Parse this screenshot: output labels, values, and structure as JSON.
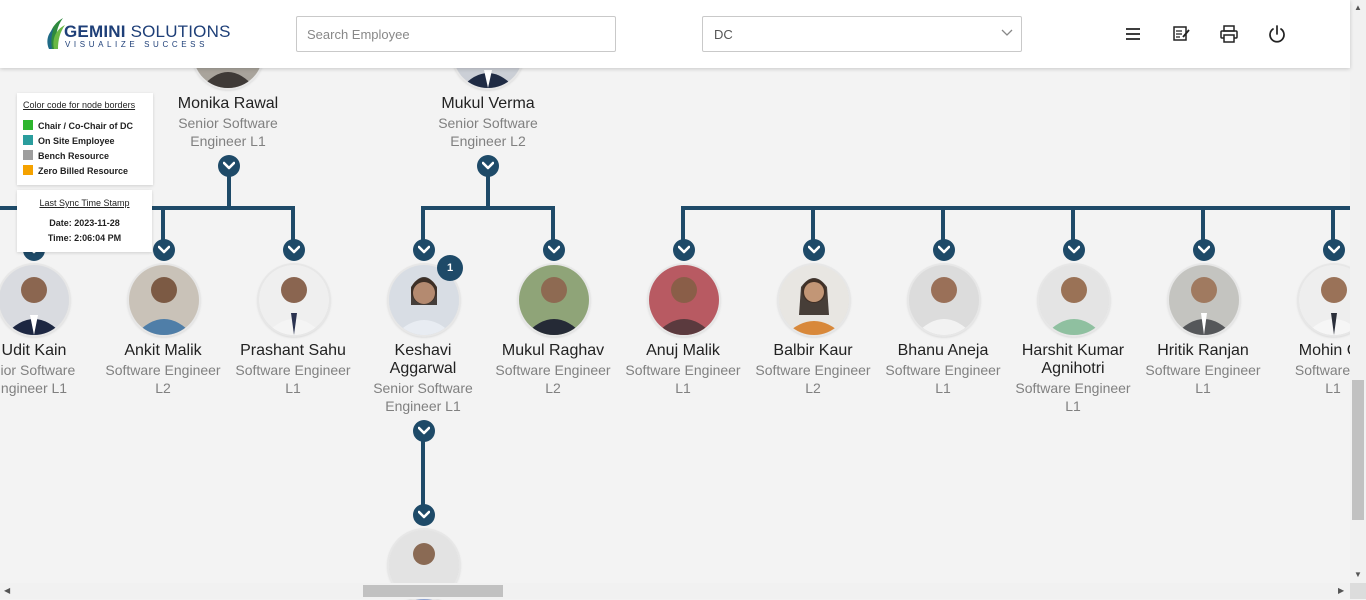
{
  "brand": {
    "name_bold": "GEMINI",
    "name_rest": " SOLUTIONS",
    "tagline": "VISUALIZE SUCCESS"
  },
  "search": {
    "placeholder": "Search Employee",
    "value": ""
  },
  "department": {
    "selected": "DC"
  },
  "toolbar": {
    "icons": [
      "menu-icon",
      "notes-icon",
      "print-icon",
      "power-icon"
    ]
  },
  "legend": {
    "title": "Color code for node borders",
    "items": [
      {
        "label": "Chair / Co-Chair of DC",
        "color": "#2db52d"
      },
      {
        "label": "On Site Employee",
        "color": "#2a9d9d"
      },
      {
        "label": "Bench Resource",
        "color": "#9e9e9e"
      },
      {
        "label": "Zero Billed Resource",
        "color": "#f5a200"
      }
    ]
  },
  "sync": {
    "title": "Last Sync Time Stamp",
    "date": "Date: 2023-11-28",
    "time": "Time: 2:06:04 PM"
  },
  "colors": {
    "connector": "#1e4a68",
    "page_bg": "#f3f3f3"
  },
  "managers": [
    {
      "name": "Monika Rawal",
      "role1": "Senior Software",
      "role2": "Engineer L1"
    },
    {
      "name": "Mukul Verma",
      "role1": "Senior Software",
      "role2": "Engineer L2"
    }
  ],
  "employees": [
    {
      "name1": "Udit Kain",
      "name2": "",
      "role1": "nior Software",
      "role2": "ngineer L1"
    },
    {
      "name1": "Ankit Malik",
      "name2": "",
      "role1": "Software Engineer",
      "role2": "L2"
    },
    {
      "name1": "Prashant Sahu",
      "name2": "",
      "role1": "Software Engineer",
      "role2": "L1"
    },
    {
      "name1": "Keshavi",
      "name2": "Aggarwal",
      "role1": "Senior Software",
      "role2": "Engineer L1",
      "badge": "1"
    },
    {
      "name1": "Mukul Raghav",
      "name2": "",
      "role1": "Software Engineer",
      "role2": "L2"
    },
    {
      "name1": "Anuj Malik",
      "name2": "",
      "role1": "Software Engineer",
      "role2": "L1"
    },
    {
      "name1": "Balbir Kaur",
      "name2": "",
      "role1": "Software Engineer",
      "role2": "L2"
    },
    {
      "name1": "Bhanu Aneja",
      "name2": "",
      "role1": "Software Engineer",
      "role2": "L1"
    },
    {
      "name1": "Harshit Kumar",
      "name2": "Agnihotri",
      "role1": "Software Engineer",
      "role2": "L1"
    },
    {
      "name1": "Hritik Ranjan",
      "name2": "",
      "role1": "Software Engineer",
      "role2": "L1"
    },
    {
      "name1": "Mohin Ch",
      "name2": "",
      "role1": "Software En",
      "role2": "L1"
    }
  ]
}
